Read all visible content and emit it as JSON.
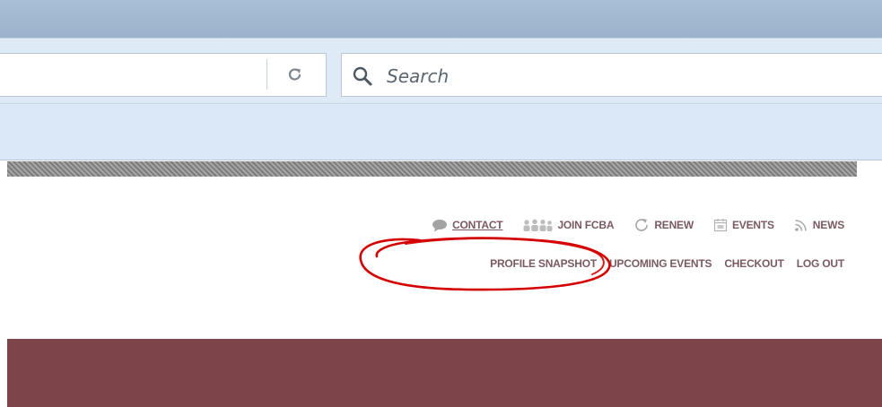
{
  "browser": {
    "search": {
      "placeholder": "Search"
    },
    "icons": {
      "reload": "reload-icon",
      "search": "search-icon"
    }
  },
  "utility_nav": {
    "items": [
      {
        "label": "CONTACT",
        "icon": "speech-bubble-icon"
      },
      {
        "label": "JOIN FCBA",
        "icon": "people-group-icon"
      },
      {
        "label": "RENEW",
        "icon": "refresh-icon"
      },
      {
        "label": "EVENTS",
        "icon": "calendar-icon"
      },
      {
        "label": "NEWS",
        "icon": "rss-icon"
      }
    ]
  },
  "account_nav": {
    "items": [
      {
        "label": "PROFILE SNAPSHOT"
      },
      {
        "label": "UPCOMING EVENTS"
      },
      {
        "label": "CHECKOUT"
      },
      {
        "label": "LOG OUT"
      }
    ]
  },
  "colors": {
    "nav_text": "#7a5a60",
    "banner": "#7d4449",
    "annotation_circle": "#d40000",
    "browser_toolbar": "#dbe8f8"
  }
}
